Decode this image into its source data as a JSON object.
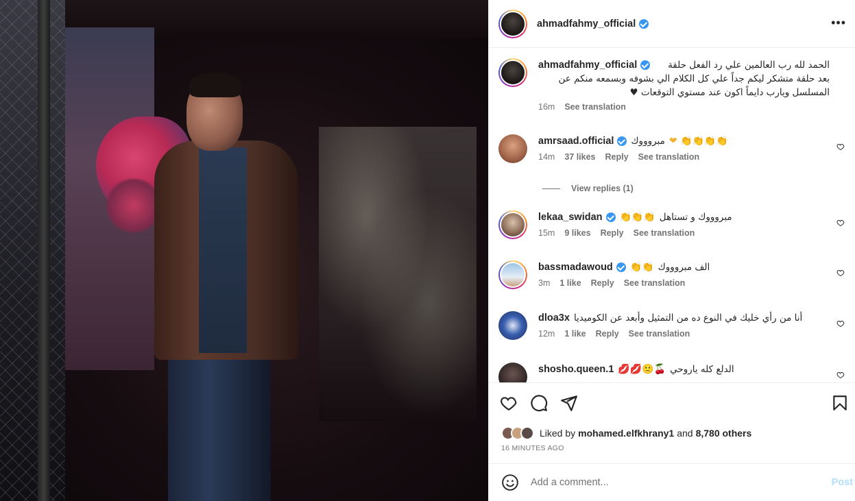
{
  "post": {
    "username": "ahmadfahmy_official"
  },
  "caption": {
    "username": "ahmadfahmy_official",
    "text_line1": "الحمد لله رب العالمين علي رد الفعل حلقة",
    "text_line2": "بعد حلقة متشكر ليكم جداً علي كل الكلام الي بشوفه وبسمعه منكم عن",
    "text_line3": "المسلسل ويارب دايماً اكون عند مستوي التوقعات ♥",
    "time": "16m",
    "see_translation": "See translation"
  },
  "comments": [
    {
      "username": "amrsaad.official",
      "verified": true,
      "text": "مبروووك",
      "emojis": "❤ 👏👏👏👏",
      "time": "14m",
      "likes": "37 likes",
      "reply": "Reply",
      "see_translation": "See translation",
      "avatar_color": "#c88a6a"
    },
    {
      "username": "lekaa_swidan",
      "verified": true,
      "text": "مبروووك و تستاهل",
      "emojis": "👏👏👏",
      "time": "15m",
      "likes": "9 likes",
      "reply": "Reply",
      "see_translation": "See translation",
      "avatar_color": "#b9a08a"
    },
    {
      "username": "bassmadawoud",
      "verified": true,
      "text": "الف مبروووك",
      "emojis": "👏👏",
      "time": "3m",
      "likes": "1 like",
      "reply": "Reply",
      "see_translation": "See translation",
      "avatar_color": "#cfd8e6"
    },
    {
      "username": "dloa3x",
      "verified": false,
      "text": "أنا من رأي خليك في النوع ده من التمثيل وأبعد عن الكوميديا",
      "emojis": "",
      "time": "12m",
      "likes": "1 like",
      "reply": "Reply",
      "see_translation": "See translation",
      "avatar_color": "#3a5fb0"
    },
    {
      "username": "shosho.queen.1",
      "verified": false,
      "text": "الدلع كله ياروحي",
      "emojis": "💋💋🙁🍒",
      "time": "",
      "likes": "",
      "reply": "",
      "see_translation": "",
      "avatar_color": "#3b3230"
    }
  ],
  "view_replies": "View replies (1)",
  "likes": {
    "prefix": "Liked by",
    "user": "mohamed.elfkhrany1",
    "and": "and",
    "others": "8,780 others"
  },
  "time_ago": "16 MINUTES AGO",
  "add_comment": {
    "placeholder": "Add a comment...",
    "post_label": "Post"
  },
  "icons": {
    "more": "more-options-icon",
    "heart": "heart-icon",
    "comment": "comment-icon",
    "share": "share-icon",
    "bookmark": "bookmark-icon",
    "emoji": "emoji-icon"
  },
  "colors": {
    "verified": "#3897f0",
    "post_button": "#b2dffc",
    "muted_text": "#737373"
  }
}
